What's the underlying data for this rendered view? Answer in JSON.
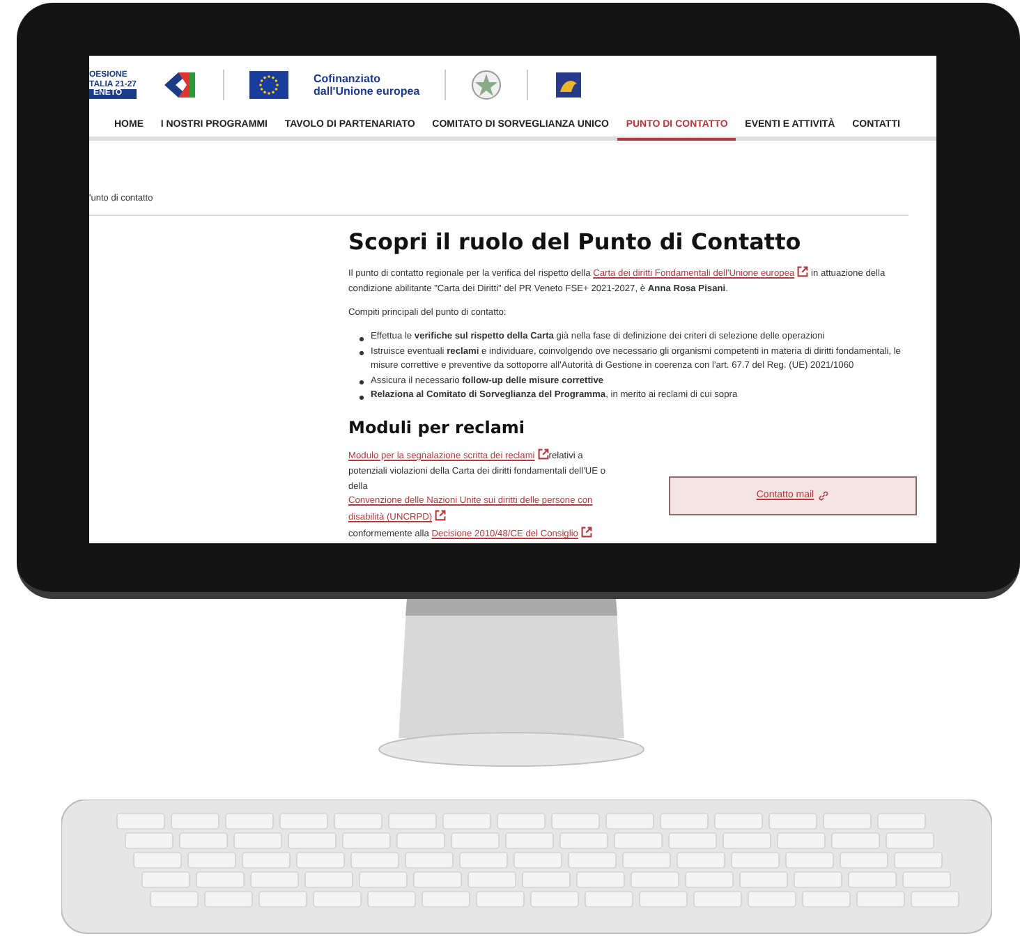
{
  "header": {
    "coesione_lines": [
      "OESIONE",
      "TALIA 21-27",
      "ENETO"
    ],
    "eu_text": [
      "Cofinanziato",
      "dall'Unione europea"
    ]
  },
  "nav": [
    {
      "label": "HOME",
      "selected": false
    },
    {
      "label": "I NOSTRI PROGRAMMI",
      "selected": false
    },
    {
      "label": "TAVOLO DI PARTENARIATO",
      "selected": false
    },
    {
      "label": "COMITATO DI SORVEGLIANZA UNICO",
      "selected": false
    },
    {
      "label": "PUNTO DI CONTATTO",
      "selected": true
    },
    {
      "label": "EVENTI E ATTIVITÀ",
      "selected": false
    },
    {
      "label": "CONTATTI",
      "selected": false
    }
  ],
  "breadcrumb": "'unto di contatto",
  "title": "Scopri il ruolo del Punto di Contatto",
  "intro": [
    {
      "kind": "text",
      "text": "Il punto di contatto regionale per la verifica del rispetto della "
    },
    {
      "kind": "link",
      "text": "Carta dei diritti Fondamentali dell'Unione europea"
    },
    {
      "kind": "text",
      "text": " in attuazione della condizione abilitante \"Carta dei Diritti\" del PR Veneto FSE+ 2021-2027, è **Anna Rosa Pisani**."
    }
  ],
  "tasks_heading": "Compiti principali del punto di contatto:",
  "tasks": [
    "Effettua le **verifiche sul rispetto della Carta** già nella fase di definizione dei criteri di selezione delle operazioni",
    "Istruisce eventuali **reclami** e individuare, coinvolgendo ove necessario gli organismi competenti in materia di diritti fondamentali, le misure correttive e preventive da sottoporre all'Autorità di Gestione in coerenza con l'art. 67.7 del Reg. (UE) 2021/1060",
    "Assicura il necessario **follow-up delle misure correttive**",
    "**Relaziona al Comitato di Sorveglianza del Programma**, in merito ai reclami di cui sopra"
  ],
  "moduli_heading": "Moduli per reclami",
  "moduli": [
    {
      "kind": "link",
      "text": "Modulo per la segnalazione scritta dei reclami"
    },
    {
      "kind": "text",
      "text": "relativi a potenziali violazioni della Carta dei diritti fondamentali dell'UE o della "
    },
    {
      "kind": "link",
      "text": "Convenzione delle Nazioni Unite sui diritti delle persone con disabilità (UNCRPD)"
    },
    {
      "kind": "text",
      "text": " conformemente alla "
    },
    {
      "kind": "link",
      "text": "Decisione 2010/48/CE del Consiglio"
    }
  ],
  "contact_button": "Contatto mail"
}
